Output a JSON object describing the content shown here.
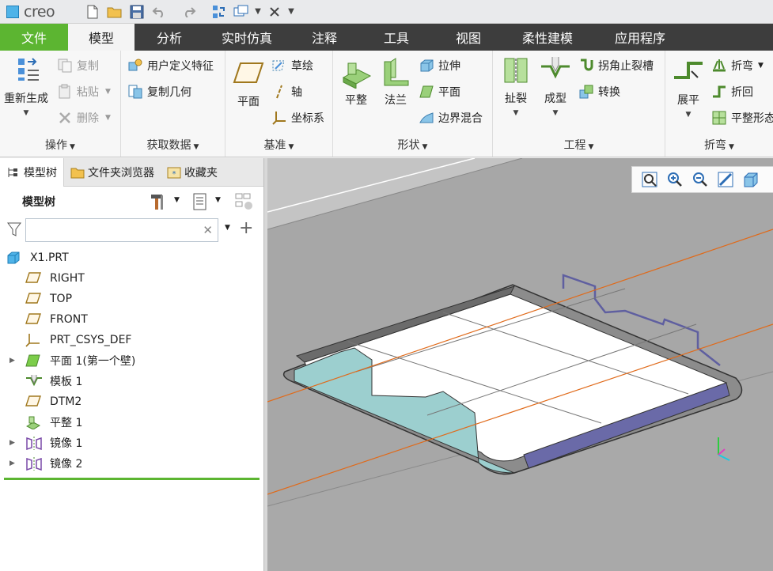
{
  "app": {
    "logo_text": "creo"
  },
  "quick_access": [
    {
      "name": "new-icon"
    },
    {
      "name": "open-icon"
    },
    {
      "name": "save-icon"
    },
    {
      "name": "undo-icon"
    },
    {
      "name": "redo-icon"
    },
    {
      "name": "regenerate-icon"
    },
    {
      "name": "windows-icon"
    },
    {
      "name": "close-window-icon"
    }
  ],
  "tabs": [
    {
      "label": "文件"
    },
    {
      "label": "模型"
    },
    {
      "label": "分析"
    },
    {
      "label": "实时仿真"
    },
    {
      "label": "注释"
    },
    {
      "label": "工具"
    },
    {
      "label": "视图"
    },
    {
      "label": "柔性建模"
    },
    {
      "label": "应用程序"
    }
  ],
  "ribbon": {
    "operations": {
      "label": "操作",
      "regenerate": "重新生成",
      "copy": "复制",
      "paste": "粘贴",
      "delete": "删除"
    },
    "get_data": {
      "label": "获取数据",
      "udf": "用户定义特征",
      "copy_geom": "复制几何"
    },
    "datum": {
      "label": "基准",
      "plane": "平面",
      "sketch": "草绘",
      "axis": "轴",
      "csys": "坐标系"
    },
    "shapes": {
      "label": "形状",
      "planar": "平整",
      "flange": "法兰",
      "extrude": "拉伸",
      "flat": "平面",
      "boundary_blend": "边界混合"
    },
    "engineering": {
      "label": "工程",
      "rip": "扯裂",
      "form": "成型",
      "corner_relief": "拐角止裂槽",
      "convert": "转换"
    },
    "bends": {
      "label": "折弯",
      "unbend": "展平",
      "bend": "折弯",
      "bend_back": "折回",
      "flat_form": "平整形态"
    }
  },
  "panel": {
    "tabs": [
      {
        "label": "模型树"
      },
      {
        "label": "文件夹浏览器"
      },
      {
        "label": "收藏夹"
      }
    ],
    "tree_title": "模型树",
    "search_placeholder": "",
    "items": [
      {
        "label": "X1.PRT",
        "icon": "part-icon",
        "expandable": false
      },
      {
        "label": "RIGHT",
        "icon": "datum-plane-icon",
        "expandable": false
      },
      {
        "label": "TOP",
        "icon": "datum-plane-icon",
        "expandable": false
      },
      {
        "label": "FRONT",
        "icon": "datum-plane-icon",
        "expandable": false
      },
      {
        "label": "PRT_CSYS_DEF",
        "icon": "csys-icon",
        "expandable": false
      },
      {
        "label": "平面 1(第一个壁)",
        "icon": "flat-wall-icon",
        "expandable": true
      },
      {
        "label": "模板 1",
        "icon": "form-icon",
        "expandable": false
      },
      {
        "label": "DTM2",
        "icon": "datum-plane-icon",
        "expandable": false
      },
      {
        "label": "平整 1",
        "icon": "unbend-icon",
        "expandable": false
      },
      {
        "label": "镜像 1",
        "icon": "mirror-icon",
        "expandable": true
      },
      {
        "label": "镜像 2",
        "icon": "mirror-icon",
        "expandable": true
      }
    ]
  },
  "viewport_tools": [
    {
      "name": "refit-icon"
    },
    {
      "name": "zoom-in-icon"
    },
    {
      "name": "zoom-out-icon"
    },
    {
      "name": "repaint-icon"
    },
    {
      "name": "saved-views-icon"
    }
  ],
  "colors": {
    "file_tab": "#5cb531",
    "tab_bar": "#3d3d3d",
    "viewport_bg": "#a9a9a9",
    "datum_line": "#e06a1a",
    "wall_surface": "#9ccfcf",
    "edge_blue": "#5f5fa0"
  }
}
